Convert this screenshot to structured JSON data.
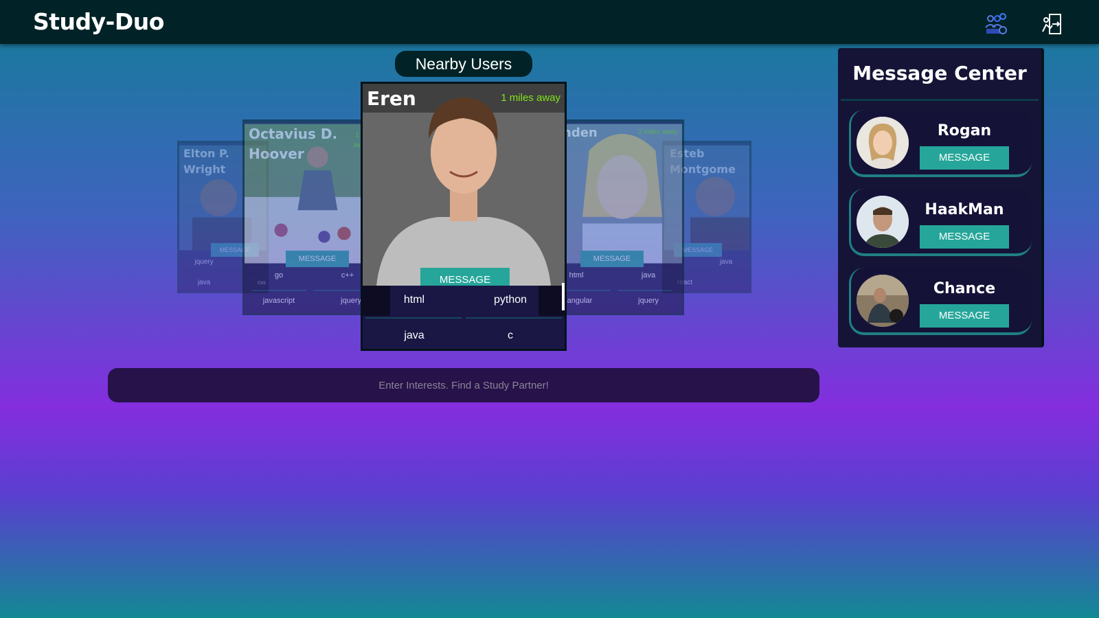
{
  "app": {
    "title": "Study-Duo"
  },
  "nav": {
    "icons": [
      "group-icon",
      "logout-icon"
    ]
  },
  "nearby": {
    "title": "Nearby Users"
  },
  "cards": [
    {
      "name_line1": "Elton P.",
      "name_line2": "Wright",
      "button": "MESSAGE",
      "tags": [
        "jquery",
        "java",
        "java"
      ]
    },
    {
      "name_line1": "Octavius D.",
      "name_line2": "Hoover",
      "distance": "1",
      "distance_rest": "av",
      "button": "MESSAGE",
      "tags": [
        "go",
        "c++",
        "css",
        "javascript",
        "jquery"
      ]
    },
    {
      "name": "Eren",
      "distance": "1 miles away",
      "button": "MESSAGE",
      "tags": [
        "html",
        "python",
        "java",
        "c"
      ]
    },
    {
      "name": "nden",
      "distance": "2 miles away",
      "button": "MESSAGE",
      "tags": [
        "html",
        "java",
        "angular",
        "jquery"
      ]
    },
    {
      "name_line1": "Esteb",
      "name_line2": "Montgome",
      "button": "MESSAGE",
      "tags": [
        "java",
        "react"
      ]
    }
  ],
  "search": {
    "placeholder": "Enter Interests. Find a Study Partner!"
  },
  "message_center": {
    "title": "Message Center",
    "contacts": [
      {
        "name": "Rogan",
        "button": "MESSAGE"
      },
      {
        "name": "HaakMan",
        "button": "MESSAGE"
      },
      {
        "name": "Chance",
        "button": "MESSAGE"
      }
    ]
  },
  "colors": {
    "accent": "#26a69a",
    "topbar": "#012226",
    "distance": "#7fe51b"
  }
}
